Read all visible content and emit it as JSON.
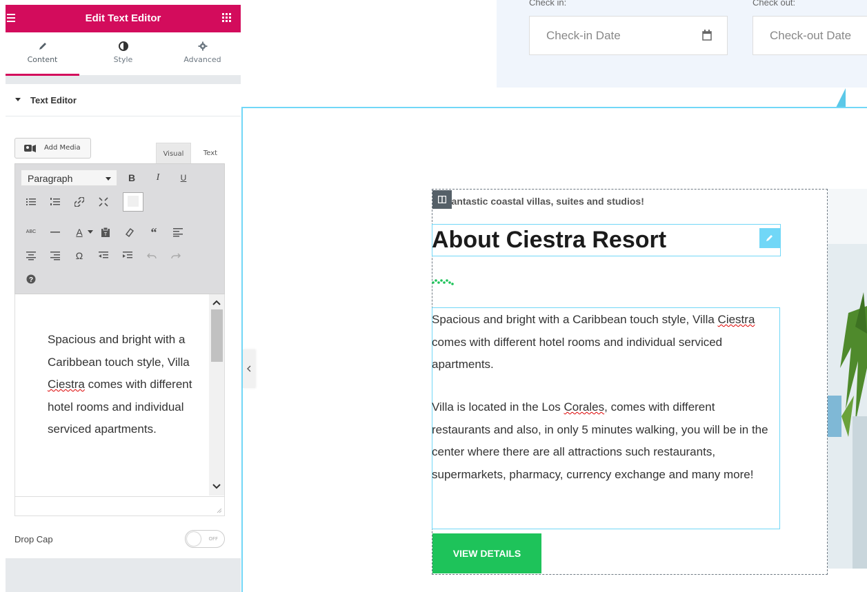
{
  "panel": {
    "title": "Edit Text Editor",
    "tabs": [
      {
        "label": "Content",
        "icon": "pencil-icon",
        "active": true
      },
      {
        "label": "Style",
        "icon": "contrast-icon",
        "active": false
      },
      {
        "label": "Advanced",
        "icon": "gear-icon",
        "active": false
      }
    ],
    "section_title": "Text Editor",
    "add_media_label": "Add Media",
    "editor_tabs": [
      "Visual",
      "Text"
    ],
    "format_select": "Paragraph",
    "editor_text": {
      "before": "Spacious and bright with a Caribbean touch style, Villa ",
      "spell": "Ciestra",
      "after": " comes with different hotel rooms and individual serviced apartments."
    },
    "drop_cap_label": "Drop Cap",
    "drop_cap_state": "OFF",
    "accent_color": "#d30c5c"
  },
  "preview": {
    "booking": {
      "checkin_label": "Check in:",
      "checkout_label": "Check out:",
      "checkin_placeholder": "Check-in Date",
      "checkout_placeholder": "Check-out Date"
    },
    "tagline": "Fantastic coastal villas, suites and studios!",
    "heading": "About Ciestra Resort",
    "paragraph1": {
      "before": "Spacious and bright with a Caribbean touch style, Villa ",
      "spell": "Ciestra",
      "after": " comes with different hotel rooms and individual serviced apartments."
    },
    "paragraph2": {
      "before": "Villa is located in the Los ",
      "spell": "Corales",
      "after": ", comes with different restaurants and also, in only 5 minutes walking, you will be in the center where there are all attractions such restaurants, supermarkets, pharmacy, currency exchange and many more!"
    },
    "button_label": "VIEW DETAILS",
    "button_color": "#1ec35a",
    "outline_color": "#71d7f7"
  }
}
